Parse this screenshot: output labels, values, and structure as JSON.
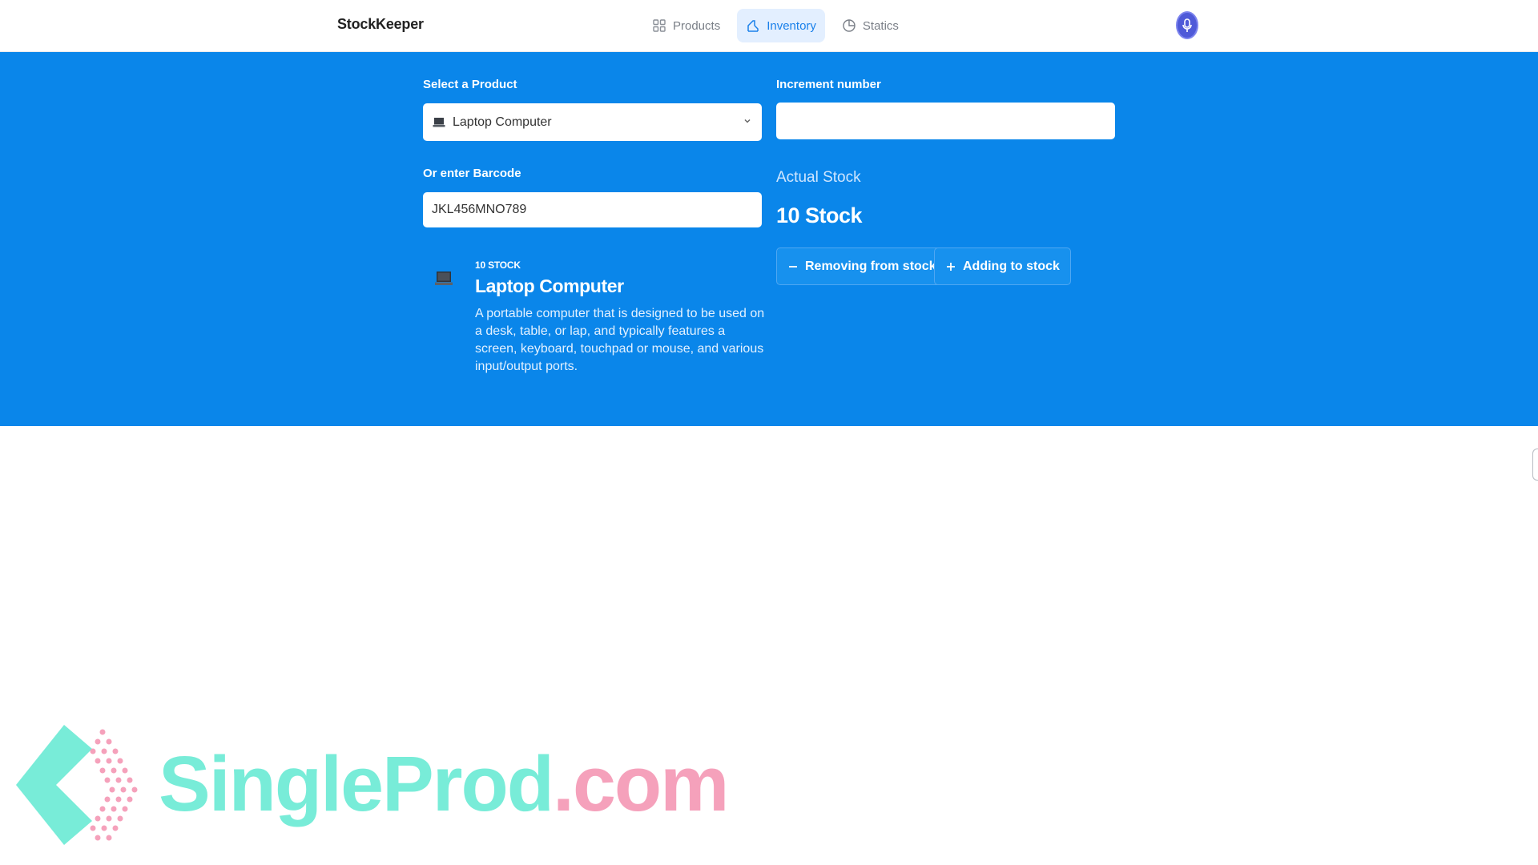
{
  "app": {
    "brand": "StockKeeper"
  },
  "nav": {
    "items": [
      {
        "label": "Products",
        "icon": "grid-icon",
        "active": false
      },
      {
        "label": "Inventory",
        "icon": "chart-icon",
        "active": true
      },
      {
        "label": "Statics",
        "icon": "pie-chart-icon",
        "active": false
      }
    ]
  },
  "form": {
    "select_label": "Select a Product",
    "selected_product": "Laptop Computer",
    "barcode_label": "Or enter Barcode",
    "barcode_value": "JKL456MNO789",
    "increment_label": "Increment number",
    "increment_value": ""
  },
  "product": {
    "stock_tag": "10 STOCK",
    "name": "Laptop Computer",
    "description": "A portable computer that is designed to be used on a desk, table, or lap, and typically features a screen, keyboard, touchpad or mouse, and various input/output ports."
  },
  "stock": {
    "label": "Actual Stock",
    "value": "10 Stock"
  },
  "actions": {
    "remove_label": "Removing from stock",
    "add_label": "Adding to stock"
  },
  "watermark": {
    "part1": "SingleProd",
    "part2": ".com"
  },
  "colors": {
    "primary": "#0a86ea",
    "active_nav_bg": "#e3efff",
    "active_nav_text": "#1a80ea",
    "avatar": "#4f5ad8",
    "watermark_teal": "#78ecd8",
    "watermark_pink": "#f5a1bb"
  }
}
